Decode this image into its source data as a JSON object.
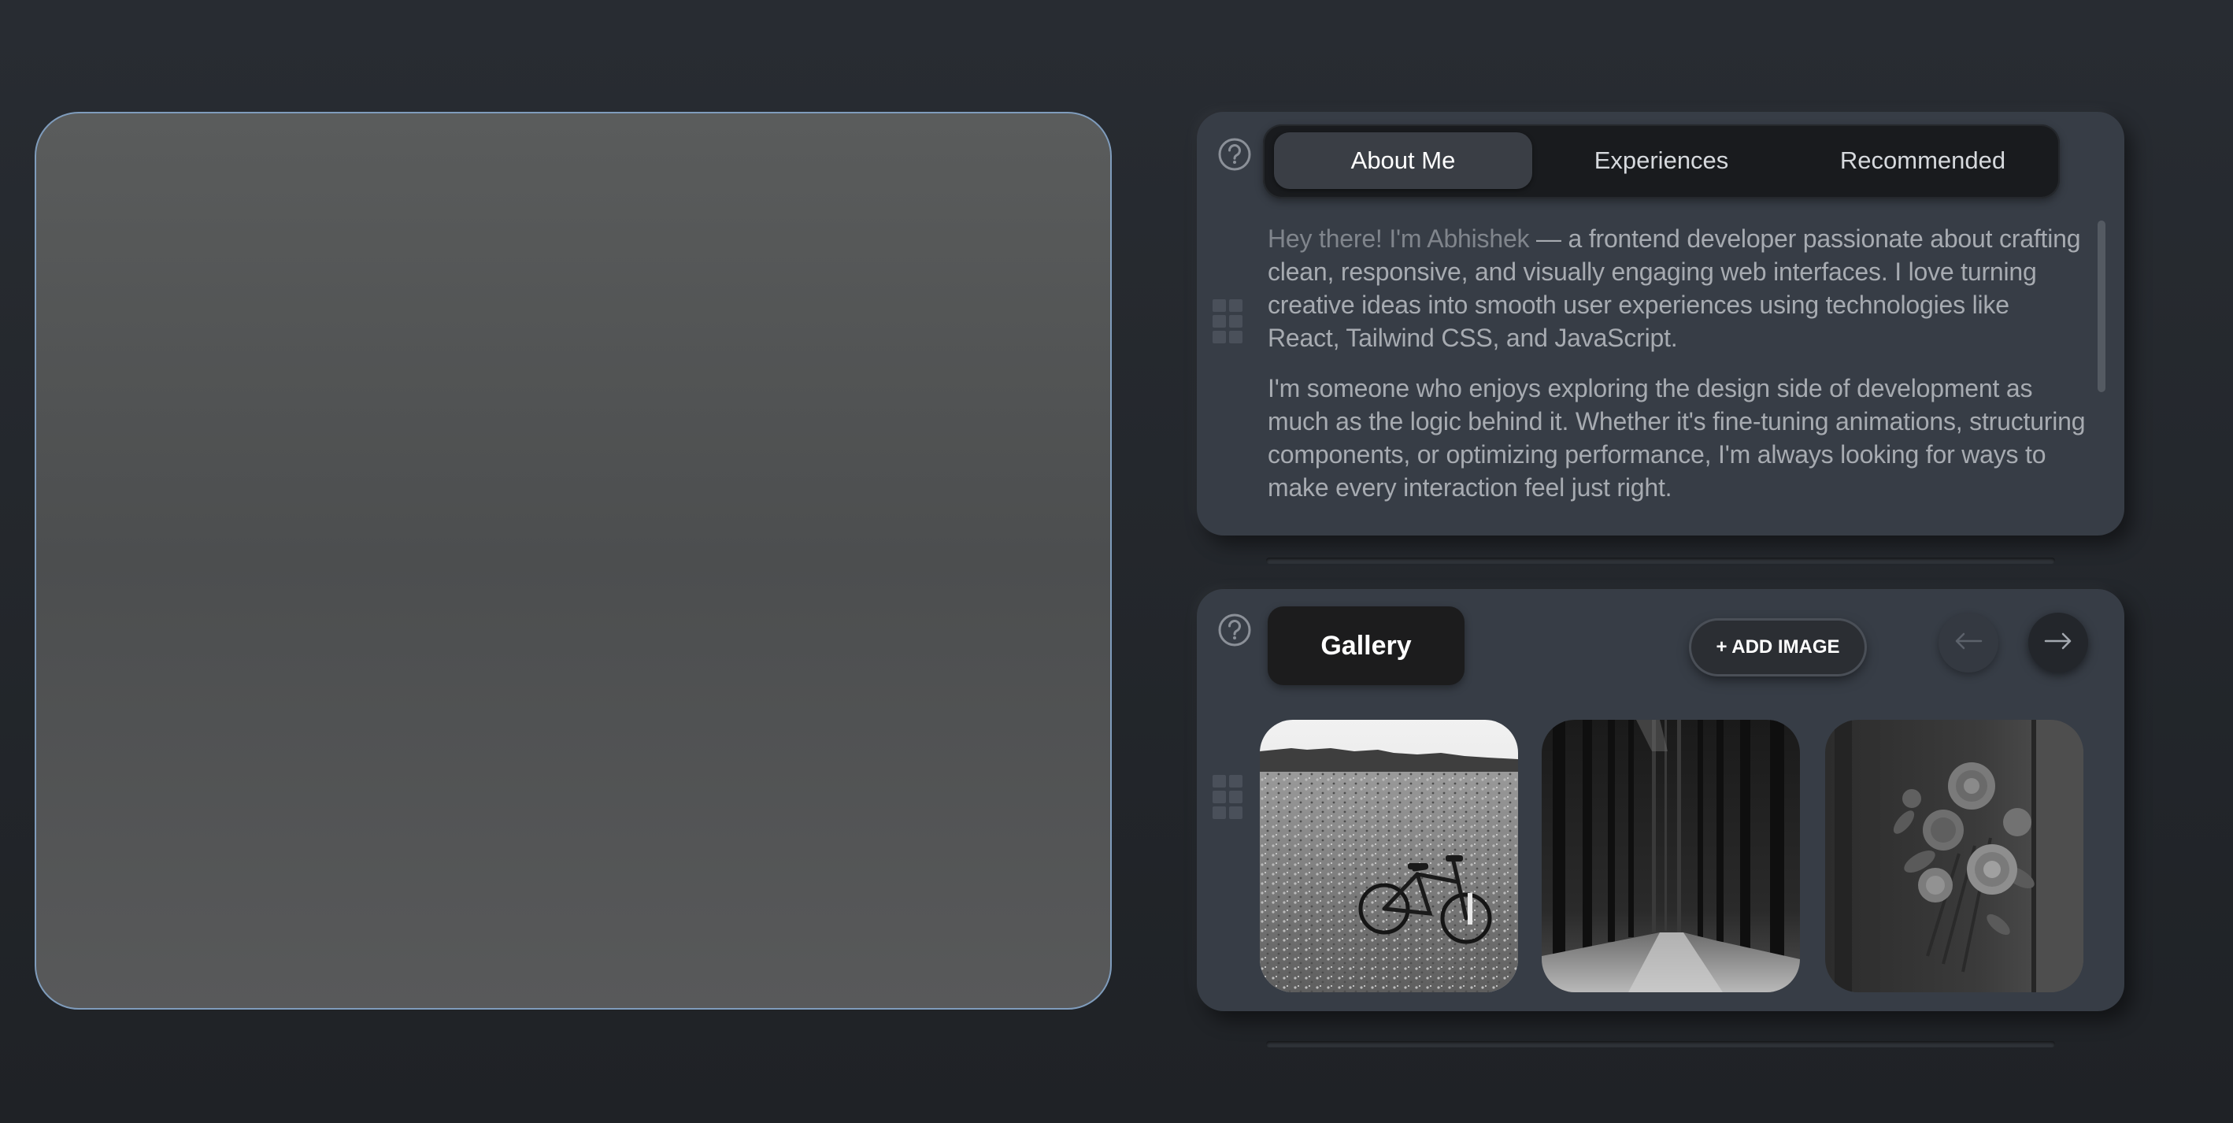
{
  "tabs": [
    {
      "label": "About Me",
      "active": true
    },
    {
      "label": "Experiences",
      "active": false
    },
    {
      "label": "Recommended",
      "active": false
    }
  ],
  "about": {
    "p1_intro": "Hey there! I'm Abhishek",
    "p1_rest": " — a frontend developer passionate about crafting clean, responsive, and visually engaging web interfaces. I love turning creative ideas into smooth user experiences using technologies like React, Tailwind CSS, and JavaScript.",
    "p2": "I'm someone who enjoys exploring the design side of development as much as the logic behind it. Whether it's fine-tuning animations, structuring components, or optimizing performance, I'm always looking for ways to make every interaction feel just right."
  },
  "gallery": {
    "title": "Gallery",
    "add_button": "+ ADD IMAGE",
    "images": [
      "bicycle-in-field",
      "snowy-forest-path",
      "rose-bouquet"
    ]
  },
  "icons": {
    "help": "help-circle-icon",
    "grid": "grid-icon",
    "prev": "arrow-left-icon",
    "next": "arrow-right-icon"
  },
  "colors": {
    "background": "#22252a",
    "card": "#373d46",
    "panel_border": "#7f9cbc",
    "tabbar": "#191b1e"
  }
}
